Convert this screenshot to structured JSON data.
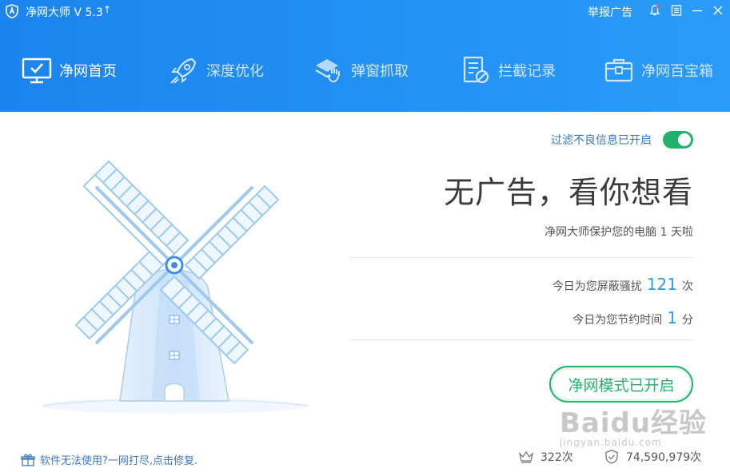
{
  "app": {
    "title": "净网大师 V 5.3",
    "upgrade_symbol": "↑"
  },
  "titlebar": {
    "report_label": "举报广告",
    "icons": [
      "bell-icon",
      "menu-icon",
      "minimize-icon",
      "close-icon"
    ]
  },
  "nav": {
    "items": [
      {
        "label": "净网首页",
        "icon": "monitor-check-icon",
        "active": true
      },
      {
        "label": "深度优化",
        "icon": "rocket-icon",
        "active": false
      },
      {
        "label": "弹窗抓取",
        "icon": "layers-hand-icon",
        "active": false
      },
      {
        "label": "拦截记录",
        "icon": "document-block-icon",
        "active": false
      },
      {
        "label": "净网百宝箱",
        "icon": "toolbox-icon",
        "active": false
      }
    ]
  },
  "main": {
    "filter_label": "过滤不良信息已开启",
    "filter_enabled": true,
    "headline": "无广告，看你想看",
    "protect_text_prefix": "净网大师保护您的电脑",
    "protect_days": "1",
    "protect_text_suffix": "天啦",
    "blocked_prefix": "今日为您屏蔽骚扰",
    "blocked_count": "121",
    "blocked_suffix": "次",
    "saved_prefix": "今日为您节约时间",
    "saved_count": "1",
    "saved_suffix": "分",
    "mode_button": "净网模式已开启"
  },
  "footer": {
    "fix_link": "软件无法使用?一网打尽,点击修复.",
    "crown_count": "322次",
    "shield_count": "74,590,979次"
  },
  "watermark": {
    "main": "Baidu经验",
    "sub": "jingyan.baidu.com"
  },
  "colors": {
    "header": "#2492f5",
    "accent_green": "#21b36b",
    "accent_blue": "#2a9bf8"
  }
}
